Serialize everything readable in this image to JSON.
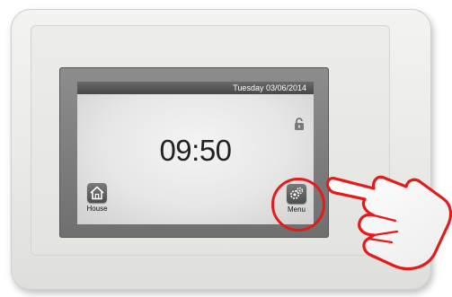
{
  "status_bar": {
    "date": "Tuesday 03/06/2014"
  },
  "clock": {
    "time": "09:50"
  },
  "buttons": {
    "house": {
      "label": "House",
      "icon": "house-icon"
    },
    "menu": {
      "label": "Menu",
      "icon": "settings-gears-icon"
    }
  },
  "lock": {
    "icon": "unlocked-padlock-icon"
  },
  "annotation": {
    "highlight_color": "#e31b1b",
    "pointer": "pointing-hand-icon"
  }
}
